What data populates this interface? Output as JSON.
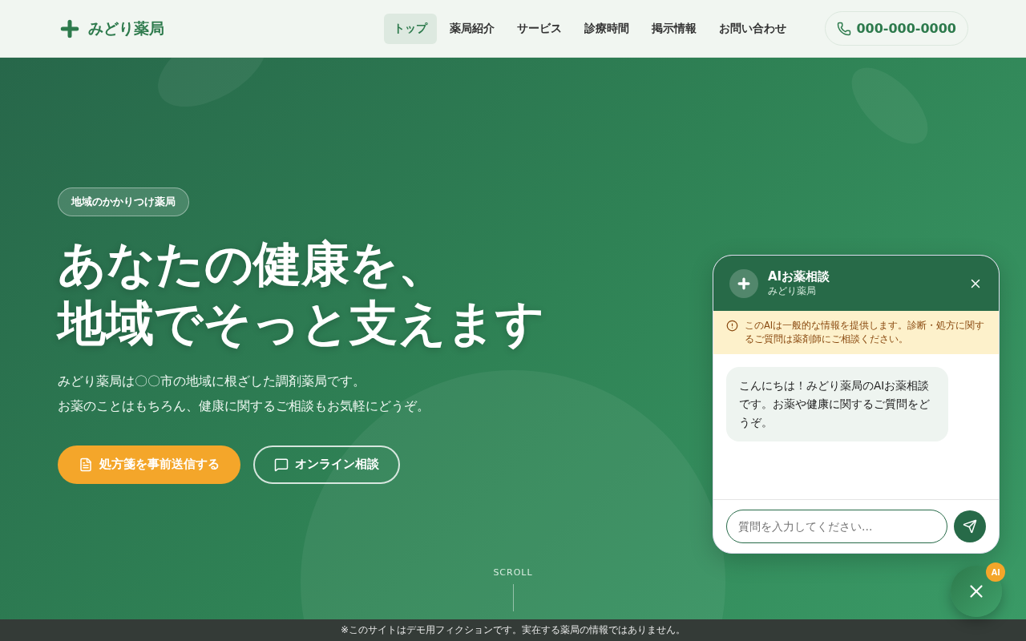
{
  "header": {
    "logo": "みどり薬局",
    "nav": [
      {
        "label": "トップ",
        "selected": true
      },
      {
        "label": "薬局紹介",
        "selected": false
      },
      {
        "label": "サービス",
        "selected": false
      },
      {
        "label": "診療時間",
        "selected": false
      },
      {
        "label": "掲示情報",
        "selected": false
      },
      {
        "label": "お問い合わせ",
        "selected": false
      }
    ],
    "phone": "000-000-0000"
  },
  "hero": {
    "badge": "地域のかかりつけ薬局",
    "headline": [
      "あなたの健康を、",
      "地域でそっと支えます"
    ],
    "lead": [
      "みどり薬局は〇〇市の地域に根ざした調剤薬局です。",
      "お薬のことはもちろん、健康に関するご相談もお気軽にどうぞ。"
    ],
    "primary_button": "処方箋を事前送信する",
    "secondary_button": "オンライン相談",
    "scroll": "SCROLL"
  },
  "chat": {
    "title": "AIお薬相談",
    "subtitle": "みどり薬局",
    "notice": "このAIは一般的な情報を提供します。診断・処方に関するご質問は薬剤師にご相談ください。",
    "messages": [
      "こんにちは！みどり薬局のAIお薬相談です。お薬や健康に関するご質問をどうぞ。"
    ],
    "placeholder": "質問を入力してください..."
  },
  "fab": {
    "badge": "AI"
  },
  "footer_notice": "※このサイトはデモ用フィクションです。実在する薬局の情報ではありません。"
}
